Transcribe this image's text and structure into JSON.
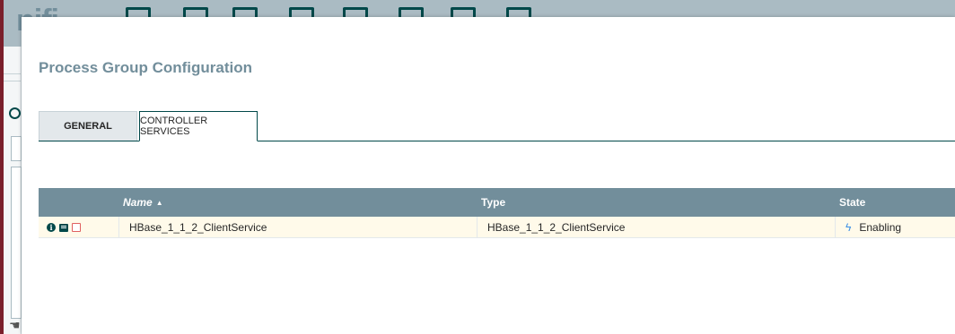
{
  "app": {
    "logo": "nifi"
  },
  "dialog": {
    "title": "Process Group Configuration",
    "tabs": [
      {
        "label": "GENERAL",
        "selected": false
      },
      {
        "label": "CONTROLLER SERVICES",
        "selected": true
      }
    ]
  },
  "table": {
    "columns": [
      {
        "label": "Name",
        "sorted": "ascending"
      },
      {
        "label": "Type"
      },
      {
        "label": "State"
      }
    ],
    "rows": [
      {
        "icons": [
          "info-icon",
          "docs-icon",
          "bulletin-icon"
        ],
        "name": "HBase_1_1_2_ClientService",
        "type": "HBase_1_1_2_ClientService",
        "state_icon": "bolt-icon",
        "state": "Enabling"
      }
    ]
  },
  "colors": {
    "header_bg": "#728e9b",
    "accent": "#004849",
    "row_highlight": "#fffaea",
    "state_icon": "#3a8ee6"
  }
}
